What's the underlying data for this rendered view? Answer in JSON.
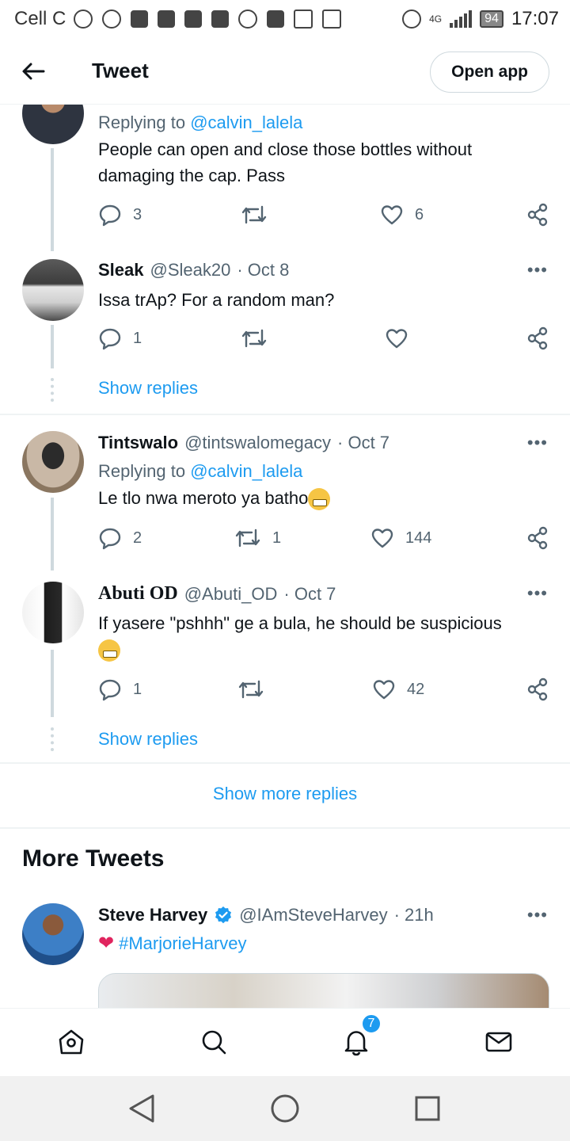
{
  "status_bar": {
    "carrier": "Cell C",
    "network": "4G",
    "battery": "94",
    "time": "17:07"
  },
  "header": {
    "title": "Tweet",
    "open_app_label": "Open app"
  },
  "tweets": [
    {
      "replying_label": "Replying to",
      "replying_handle": "@calvin_lalela",
      "text": "People can open and close those bottles without damaging the cap.  Pass",
      "replies": "3",
      "retweets": "",
      "likes": "6"
    },
    {
      "name": "Sleak",
      "handle": "@Sleak20",
      "date": "· Oct 8",
      "text": "Issa trAp? For a random man?",
      "replies": "1",
      "retweets": "",
      "likes": "",
      "show_replies": "Show replies"
    },
    {
      "name": "Tintswalo",
      "handle": "@tintswalomegacy",
      "date": "· Oct 7",
      "replying_label": "Replying to",
      "replying_handle": "@calvin_lalela",
      "text": "Le tlo nwa meroto ya batho",
      "replies": "2",
      "retweets": "1",
      "likes": "144"
    },
    {
      "name": "Abuti OD",
      "handle": "@Abuti_OD",
      "date": "· Oct 7",
      "text": "If yasere \"pshhh\" ge a bula, he should be suspicious",
      "replies": "1",
      "retweets": "",
      "likes": "42",
      "show_replies": "Show replies"
    }
  ],
  "show_more_replies": "Show more replies",
  "more_tweets": {
    "title": "More Tweets",
    "tweet": {
      "name": "Steve Harvey",
      "handle": "@IAmSteveHarvey",
      "date": "· 21h",
      "hashtag": "#MarjorieHarvey"
    }
  },
  "more_menu": "•••",
  "bottom_nav": {
    "notifications_badge": "7"
  },
  "colors": {
    "accent": "#1d9bf0",
    "text": "#0f1419",
    "muted": "#536471",
    "line": "#cfd9de"
  }
}
